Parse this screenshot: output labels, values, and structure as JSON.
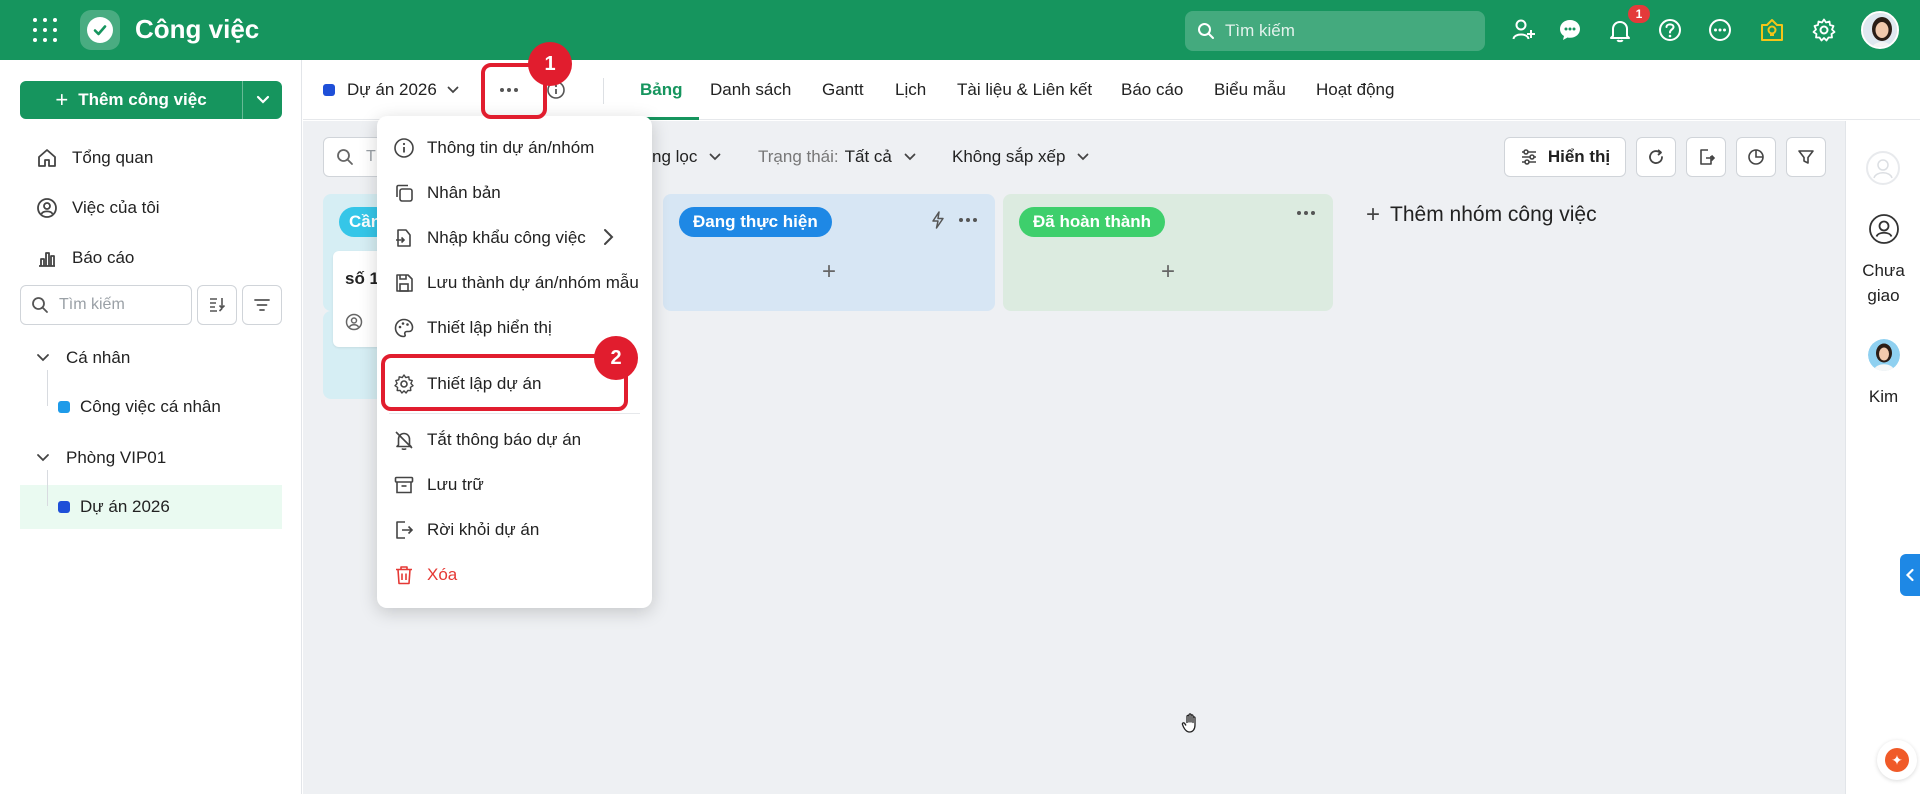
{
  "app": {
    "title": "Công việc"
  },
  "topbar": {
    "search_placeholder": "Tìm kiếm",
    "notification_count": "1",
    "icons": [
      "add-user-icon",
      "chat-icon",
      "bell-icon",
      "help-icon",
      "more-circle-icon",
      "lightbulb-icon",
      "gear-icon"
    ]
  },
  "sidebar": {
    "add_task_label": "Thêm công việc",
    "nav": [
      {
        "label": "Tổng quan",
        "icon": "home-icon"
      },
      {
        "label": "Việc của tôi",
        "icon": "user-circle-icon"
      },
      {
        "label": "Báo cáo",
        "icon": "bar-chart-icon"
      }
    ],
    "search_placeholder": "Tìm kiếm",
    "groups": [
      {
        "label": "Cá nhân",
        "items": [
          {
            "label": "Công việc cá nhân",
            "color": "#1e9be9"
          }
        ]
      },
      {
        "label": "Phòng VIP01",
        "items": [
          {
            "label": "Dự án 2026",
            "color": "#1e4fd8",
            "active": true
          }
        ]
      }
    ]
  },
  "project": {
    "name": "Dự án 2026",
    "color": "#1e4fd8",
    "tabs": [
      "Bảng",
      "Danh sách",
      "Gantt",
      "Lịch",
      "Tài liệu & Liên kết",
      "Báo cáo",
      "Biểu mẫu",
      "Hoạt động"
    ],
    "active_tab": "Bảng"
  },
  "toolbar": {
    "search_placeholder": "T",
    "filter_label": "ng lọc",
    "status_label": "Trạng thái:",
    "status_value": "Tất cả",
    "sort_label": "Không sắp xếp",
    "display_button": "Hiển thị"
  },
  "board": {
    "columns": [
      {
        "name": "Cần",
        "chip_color": "#35c6e8",
        "bg": "#d6eef4",
        "card_title": "số 1"
      },
      {
        "name": "Đang thực hiện",
        "chip_color": "#1e88e5",
        "bg": "#d7e6f4"
      },
      {
        "name": "Đã hoàn thành",
        "chip_color": "#3ecf6c",
        "bg": "#dcebe0"
      }
    ],
    "add_group_label": "Thêm nhóm công việc"
  },
  "right_panel": {
    "items": [
      {
        "label": "Chưa giao"
      },
      {
        "label": "Kim"
      }
    ]
  },
  "menu": {
    "items": [
      {
        "label": "Thông tin dự án/nhóm",
        "icon": "info-icon"
      },
      {
        "label": "Nhân bản",
        "icon": "copy-icon"
      },
      {
        "label": "Nhập khẩu công việc",
        "icon": "import-file-icon",
        "has_submenu": true
      },
      {
        "label": "Lưu thành dự án/nhóm mẫu",
        "icon": "save-icon"
      },
      {
        "label": "Thiết lập hiển thị",
        "icon": "palette-icon"
      },
      {
        "label": "Thiết lập dự án",
        "icon": "gear-icon"
      },
      {
        "label": "Tắt thông báo dự án",
        "icon": "bell-off-icon"
      },
      {
        "label": "Lưu trữ",
        "icon": "archive-icon"
      },
      {
        "label": "Rời khỏi dự án",
        "icon": "logout-icon"
      },
      {
        "label": "Xóa",
        "icon": "trash-icon",
        "danger": true
      }
    ]
  },
  "annotations": {
    "step1": "1",
    "step2": "2",
    "highlight_color": "#e11d2e"
  }
}
